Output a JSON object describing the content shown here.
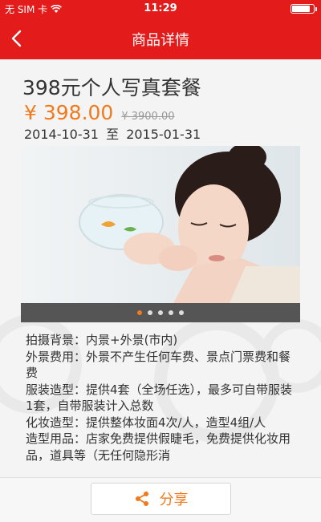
{
  "status_bar": {
    "carrier": "无 SIM 卡",
    "time": "11:29",
    "battery_level": 0.9
  },
  "nav": {
    "title": "商品详情",
    "back_icon": "chevron-left-icon"
  },
  "product": {
    "title": "398元个人写真套餐",
    "price": "¥ 398.00",
    "original_price": "¥ 3900.00",
    "date_start": "2014-10-31",
    "date_sep": "至",
    "date_end": "2015-01-31"
  },
  "carousel": {
    "slide_count": 5,
    "active_index": 0
  },
  "details": [
    "拍摄背景：内景+外景(市内)",
    "外景费用：外景不产生任何车费、景点门票费和餐费",
    "服装造型：提供4套（全场任选），最多可自带服装1套，自带服装计入总数",
    "化妆造型：提供整体妆面4次/人，造型4组/人",
    "造型用品：店家免费提供假睫毛，免费提供化妆用品，道具等（无任何隐形消"
  ],
  "footer": {
    "share_label": "分享",
    "share_icon": "share-icon"
  },
  "colors": {
    "brand_red": "#e31b1b",
    "accent_orange": "#f07a1d"
  }
}
